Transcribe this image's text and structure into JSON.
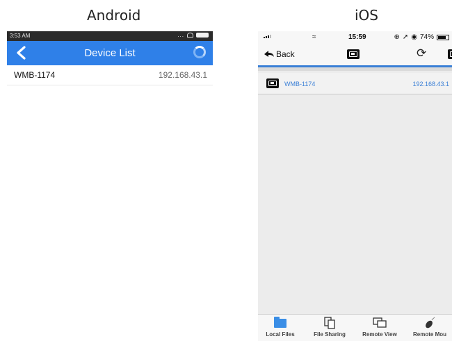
{
  "labels": {
    "android": "Android",
    "ios": "iOS"
  },
  "android": {
    "status_time": "3:53 AM",
    "status_extra": "...",
    "title": "Device List",
    "devices": [
      {
        "name": "WMB-1174",
        "ip": "192.168.43.1"
      }
    ]
  },
  "ios": {
    "status_time": "15:59",
    "status_battery": "74%",
    "back_label": "Back",
    "devices": [
      {
        "name": "WMB-1174",
        "ip": "192.168.43.1"
      }
    ],
    "tabs": [
      {
        "label": "Local Files",
        "icon": "folder-icon"
      },
      {
        "label": "File Sharing",
        "icon": "file-sharing-icon"
      },
      {
        "label": "Remote View",
        "icon": "remote-view-icon"
      },
      {
        "label": "Remote Mou",
        "icon": "remote-mouse-icon"
      }
    ]
  },
  "colors": {
    "android_bar": "#2f80e8",
    "ios_accent": "#3a7fd6"
  }
}
